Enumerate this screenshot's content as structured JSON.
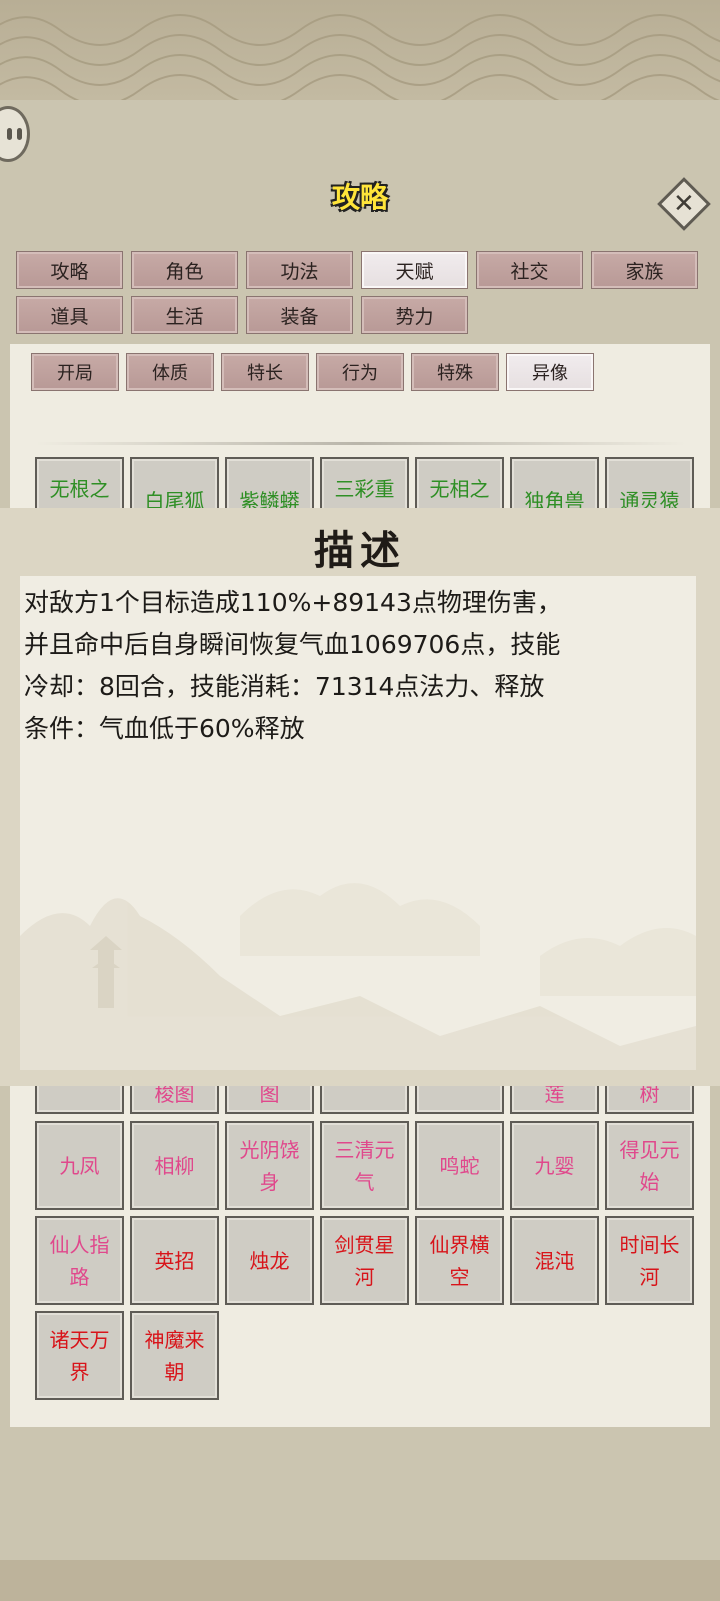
{
  "header": {
    "title": "攻略",
    "close_label": "✕"
  },
  "tabs": [
    {
      "label": "攻略",
      "active": false
    },
    {
      "label": "角色",
      "active": false
    },
    {
      "label": "功法",
      "active": false
    },
    {
      "label": "天赋",
      "active": true
    },
    {
      "label": "社交",
      "active": false
    },
    {
      "label": "家族",
      "active": false
    },
    {
      "label": "道具",
      "active": false
    },
    {
      "label": "生活",
      "active": false
    },
    {
      "label": "装备",
      "active": false
    },
    {
      "label": "势力",
      "active": false
    }
  ],
  "subtabs": [
    {
      "label": "开局",
      "active": false
    },
    {
      "label": "体质",
      "active": false
    },
    {
      "label": "特长",
      "active": false
    },
    {
      "label": "行为",
      "active": false
    },
    {
      "label": "特殊",
      "active": false
    },
    {
      "label": "异像",
      "active": true
    }
  ],
  "grid_top_row": [
    {
      "label": "无根之",
      "color": "#2f8f25"
    },
    {
      "label": "白尾狐",
      "color": "#2f8f25"
    },
    {
      "label": "紫鳞蟒",
      "color": "#2f8f25"
    },
    {
      "label": "三彩重",
      "color": "#2f8f25"
    },
    {
      "label": "无相之",
      "color": "#2f8f25"
    },
    {
      "label": "独角兽",
      "color": "#2f8f25"
    },
    {
      "label": "通灵猿",
      "color": "#2f8f25"
    }
  ],
  "grid_partial_row": [
    {
      "label": "",
      "color": "#e0488c"
    },
    {
      "label": "梭图",
      "color": "#e0488c"
    },
    {
      "label": "图",
      "color": "#e0488c"
    },
    {
      "label": "",
      "color": "#e0488c"
    },
    {
      "label": "",
      "color": "#e0488c"
    },
    {
      "label": "莲",
      "color": "#e0488c"
    },
    {
      "label": "树",
      "color": "#e0488c"
    }
  ],
  "grid_rows": [
    [
      {
        "line1": "九凤",
        "line2": "",
        "color": "#e0488c"
      },
      {
        "line1": "相柳",
        "line2": "",
        "color": "#e0488c"
      },
      {
        "line1": "光阴饶",
        "line2": "身",
        "color": "#e0488c"
      },
      {
        "line1": "三清元",
        "line2": "气",
        "color": "#e0488c"
      },
      {
        "line1": "鸣蛇",
        "line2": "",
        "color": "#e0488c"
      },
      {
        "line1": "九婴",
        "line2": "",
        "color": "#e0488c"
      },
      {
        "line1": "得见元",
        "line2": "始",
        "color": "#e0488c"
      }
    ],
    [
      {
        "line1": "仙人指",
        "line2": "路",
        "color": "#e0488c"
      },
      {
        "line1": "英招",
        "line2": "",
        "color": "#d8141a"
      },
      {
        "line1": "烛龙",
        "line2": "",
        "color": "#d8141a"
      },
      {
        "line1": "剑贯星",
        "line2": "河",
        "color": "#d8141a"
      },
      {
        "line1": "仙界横",
        "line2": "空",
        "color": "#d8141a"
      },
      {
        "line1": "混沌",
        "line2": "",
        "color": "#d8141a"
      },
      {
        "line1": "时间长",
        "line2": "河",
        "color": "#d8141a"
      }
    ],
    [
      {
        "line1": "诸天万",
        "line2": "界",
        "color": "#d8141a"
      },
      {
        "line1": "神魔来",
        "line2": "朝",
        "color": "#d8141a"
      }
    ]
  ],
  "description": {
    "title": "描述",
    "lines": [
      "对敌方1个目标造成110%+89143点物理伤害，",
      "并且命中后自身瞬间恢复气血1069706点，技能",
      "冷却：8回合，技能消耗：71314点法力、释放",
      "条件：气血低于60%释放"
    ]
  },
  "icons": {
    "menu": "menu-dots-icon",
    "close": "close-icon"
  }
}
